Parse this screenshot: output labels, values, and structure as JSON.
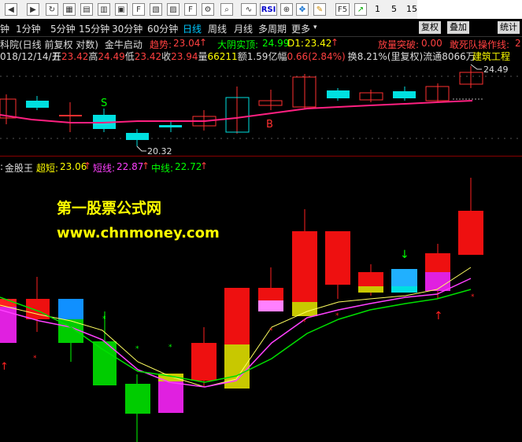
{
  "toolbar": {
    "icons": [
      "back-icon",
      "forward-icon",
      "refresh-icon",
      "grid-icon",
      "f6-icon",
      "f7-icon",
      "f8-icon",
      "f9-icon",
      "f10-icon",
      "kline-icon",
      "zoom-icon",
      "tools-icon",
      "f10b-icon",
      "magnify-icon",
      "rsi-label",
      "move-icon",
      "pencil-icon",
      "f5-icon",
      "trend-icon"
    ],
    "rsi": "RSI",
    "f5": "F5",
    "nums": [
      "1",
      "5",
      "15"
    ]
  },
  "periods": {
    "items": [
      "钟",
      "1分钟",
      "5分钟",
      "15分钟",
      "30分钟",
      "60分钟",
      "日线",
      "周线",
      "月线",
      "多周期",
      "更多"
    ],
    "more_arrow": "▾",
    "active_index": 6,
    "side_buttons": [
      "复权",
      "叠加",
      "统计"
    ]
  },
  "info1": {
    "stock": "科院(日线 前复权 对数)",
    "indicator": "金牛启动",
    "trend_label": "趋势:",
    "trend_value": "23.04",
    "dayang_label": "大阴实顶:",
    "dayang_value": "24.99",
    "d1_label": "D1:",
    "d1_value": "23.42",
    "vol_label": "放量突破:",
    "vol_value": "0.00",
    "dare_label": "敢死队操作线:",
    "dare_value": "2"
  },
  "info2": {
    "date": "018/12/14/五",
    "open_label": "开",
    "open": "23.42",
    "high_label": "高",
    "high": "24.49",
    "low_label": "低",
    "low": "23.42",
    "close_label": "收",
    "close": "23.94",
    "vol_label": "量",
    "vol": "66211",
    "amt_label": "额",
    "amt": "1.59亿",
    "chg_label": "幅",
    "chg": "0.66(2.84%)",
    "turn_label": "换",
    "turn": "8.21%(里复权)",
    "float_label": "流通",
    "float": "8066万",
    "right_text": "建筑工程"
  },
  "upper_chart": {
    "high_label": "24.49",
    "low_label": "20.32",
    "marks": [
      "S",
      "B"
    ]
  },
  "lower_header": {
    "name": "金股王",
    "super_label": "超短:",
    "super_value": "23.06",
    "short_label": "短线:",
    "short_value": "22.87",
    "mid_label": "中线:",
    "mid_value": "22.72"
  },
  "watermark": {
    "line1": "第一股票公式网",
    "line2": "www.chnmoney.com"
  },
  "colors": {
    "up": "#ff3030",
    "down": "#00e0e0",
    "yellow": "#ffff00",
    "magenta": "#ff40ff",
    "green": "#00ff00",
    "active": "#00c8ff"
  }
}
